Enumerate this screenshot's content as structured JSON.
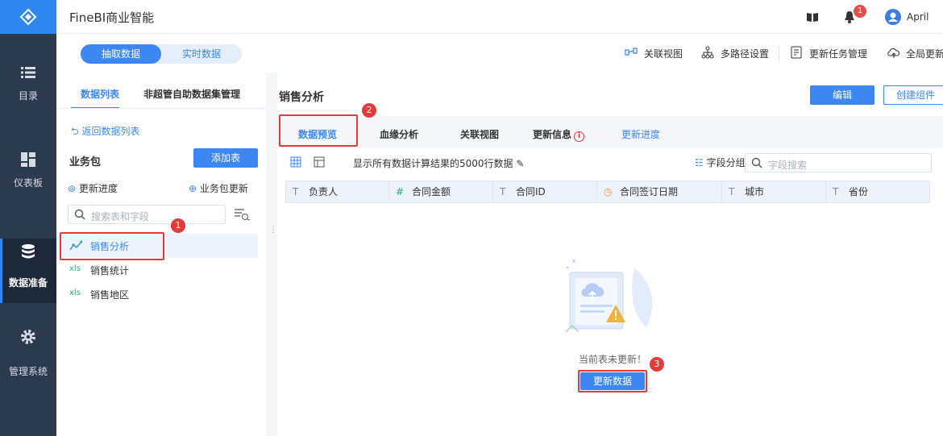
{
  "app": {
    "name": "FineBI商业智能",
    "user": "April",
    "notification_count": "1"
  },
  "sidebar": {
    "items": [
      {
        "label": "目录",
        "icon": "list-icon"
      },
      {
        "label": "仪表板",
        "icon": "dashboard-icon"
      },
      {
        "label": "数据准备",
        "icon": "database-icon",
        "active": true
      },
      {
        "label": "管理系统",
        "icon": "gear-icon"
      }
    ]
  },
  "mode": {
    "extract": "抽取数据",
    "realtime": "实时数据"
  },
  "toolbar": {
    "relation_view": "关联视图",
    "multipath": "多路径设置",
    "task_manage": "更新任务管理",
    "global_update": "全局更新"
  },
  "left": {
    "tab_list": "数据列表",
    "tab_manage": "非超管自助数据集管理",
    "back": "返回数据列表",
    "package": "业务包",
    "add_table": "添加表",
    "update_progress": "更新进度",
    "package_update": "业务包更新",
    "search_placeholder": "搜索表和字段",
    "items": [
      {
        "label": "销售分析",
        "type": "analysis"
      },
      {
        "label": "销售统计",
        "type": "xls"
      },
      {
        "label": "销售地区",
        "type": "xls"
      }
    ]
  },
  "main": {
    "title": "销售分析",
    "edit": "编辑",
    "create": "创建组件",
    "tabs": [
      "数据预览",
      "血缘分析",
      "关联视图",
      "更新信息",
      "更新进度"
    ],
    "info": "显示所有数据计算结果的5000行数据",
    "group": "字段分组",
    "field_search_placeholder": "字段搜索",
    "columns": [
      {
        "type": "T",
        "name": "负责人"
      },
      {
        "type": "#",
        "name": "合同金额"
      },
      {
        "type": "T",
        "name": "合同ID"
      },
      {
        "type": "clock",
        "name": "合同签订日期"
      },
      {
        "type": "T",
        "name": "城市"
      },
      {
        "type": "T",
        "name": "省份"
      }
    ],
    "empty_text": "当前表未更新！",
    "update_button": "更新数据"
  },
  "annotations": [
    "1",
    "2",
    "3"
  ]
}
